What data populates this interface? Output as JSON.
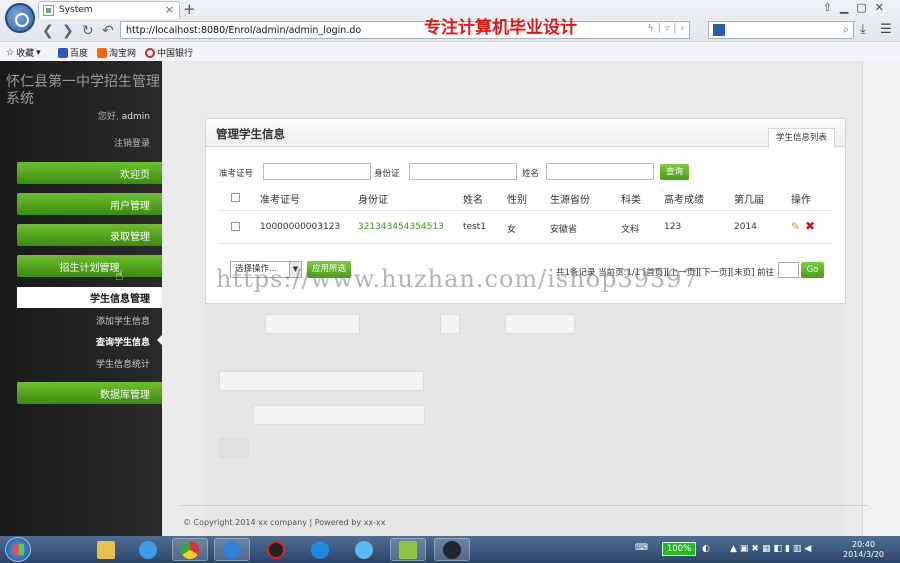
{
  "browser": {
    "tab_title": "System",
    "address": "http://localhost:8080/Enrol/admin/admin_login.do",
    "overlay_banner": "专注计算机毕业设计",
    "bookmarks": [
      "收藏",
      "百度",
      "淘宝网",
      "中国银行"
    ]
  },
  "sidebar": {
    "site_title": "怀仁县第一中学招生管理系统",
    "greeting_prefix": "您好,",
    "username": "admin",
    "logout": "注销登录",
    "menu": [
      "欢迎页",
      "用户管理",
      "录取管理",
      "招生计划管理"
    ],
    "submenu_header": "学生信息管理",
    "submenu": [
      "添加学生信息",
      "查询学生信息",
      "学生信息统计"
    ],
    "db_menu": "数据库管理"
  },
  "panel": {
    "title": "管理学生信息",
    "tab": "学生信息列表",
    "filters": {
      "exam_no_label": "准考证号",
      "id_label": "身份证",
      "name_label": "姓名",
      "search_button": "查询"
    },
    "columns": [
      "准考证号",
      "身份证",
      "姓名",
      "性别",
      "生源省份",
      "科类",
      "高考成绩",
      "第几届",
      "操作"
    ],
    "rows": [
      {
        "exam_no": "10000000003123",
        "id_card": "321343454354513",
        "name": "test1",
        "gender": "女",
        "province": "安徽省",
        "category": "文科",
        "score": "123",
        "session": "2014"
      }
    ],
    "bulk_select": "选择操作...",
    "apply_button": "应用所选",
    "pager_text": "共1条记录 当前页:1/1 [首页][上一页][下一页][末页] 前往",
    "go_button": "Go"
  },
  "watermark": "https://www.huzhan.com/ishop39397",
  "footer": "© Copyright 2014 xx company | Powered by xx-xx",
  "taskbar": {
    "battery": "100%",
    "time": "20:40",
    "date": "2014/3/20"
  }
}
